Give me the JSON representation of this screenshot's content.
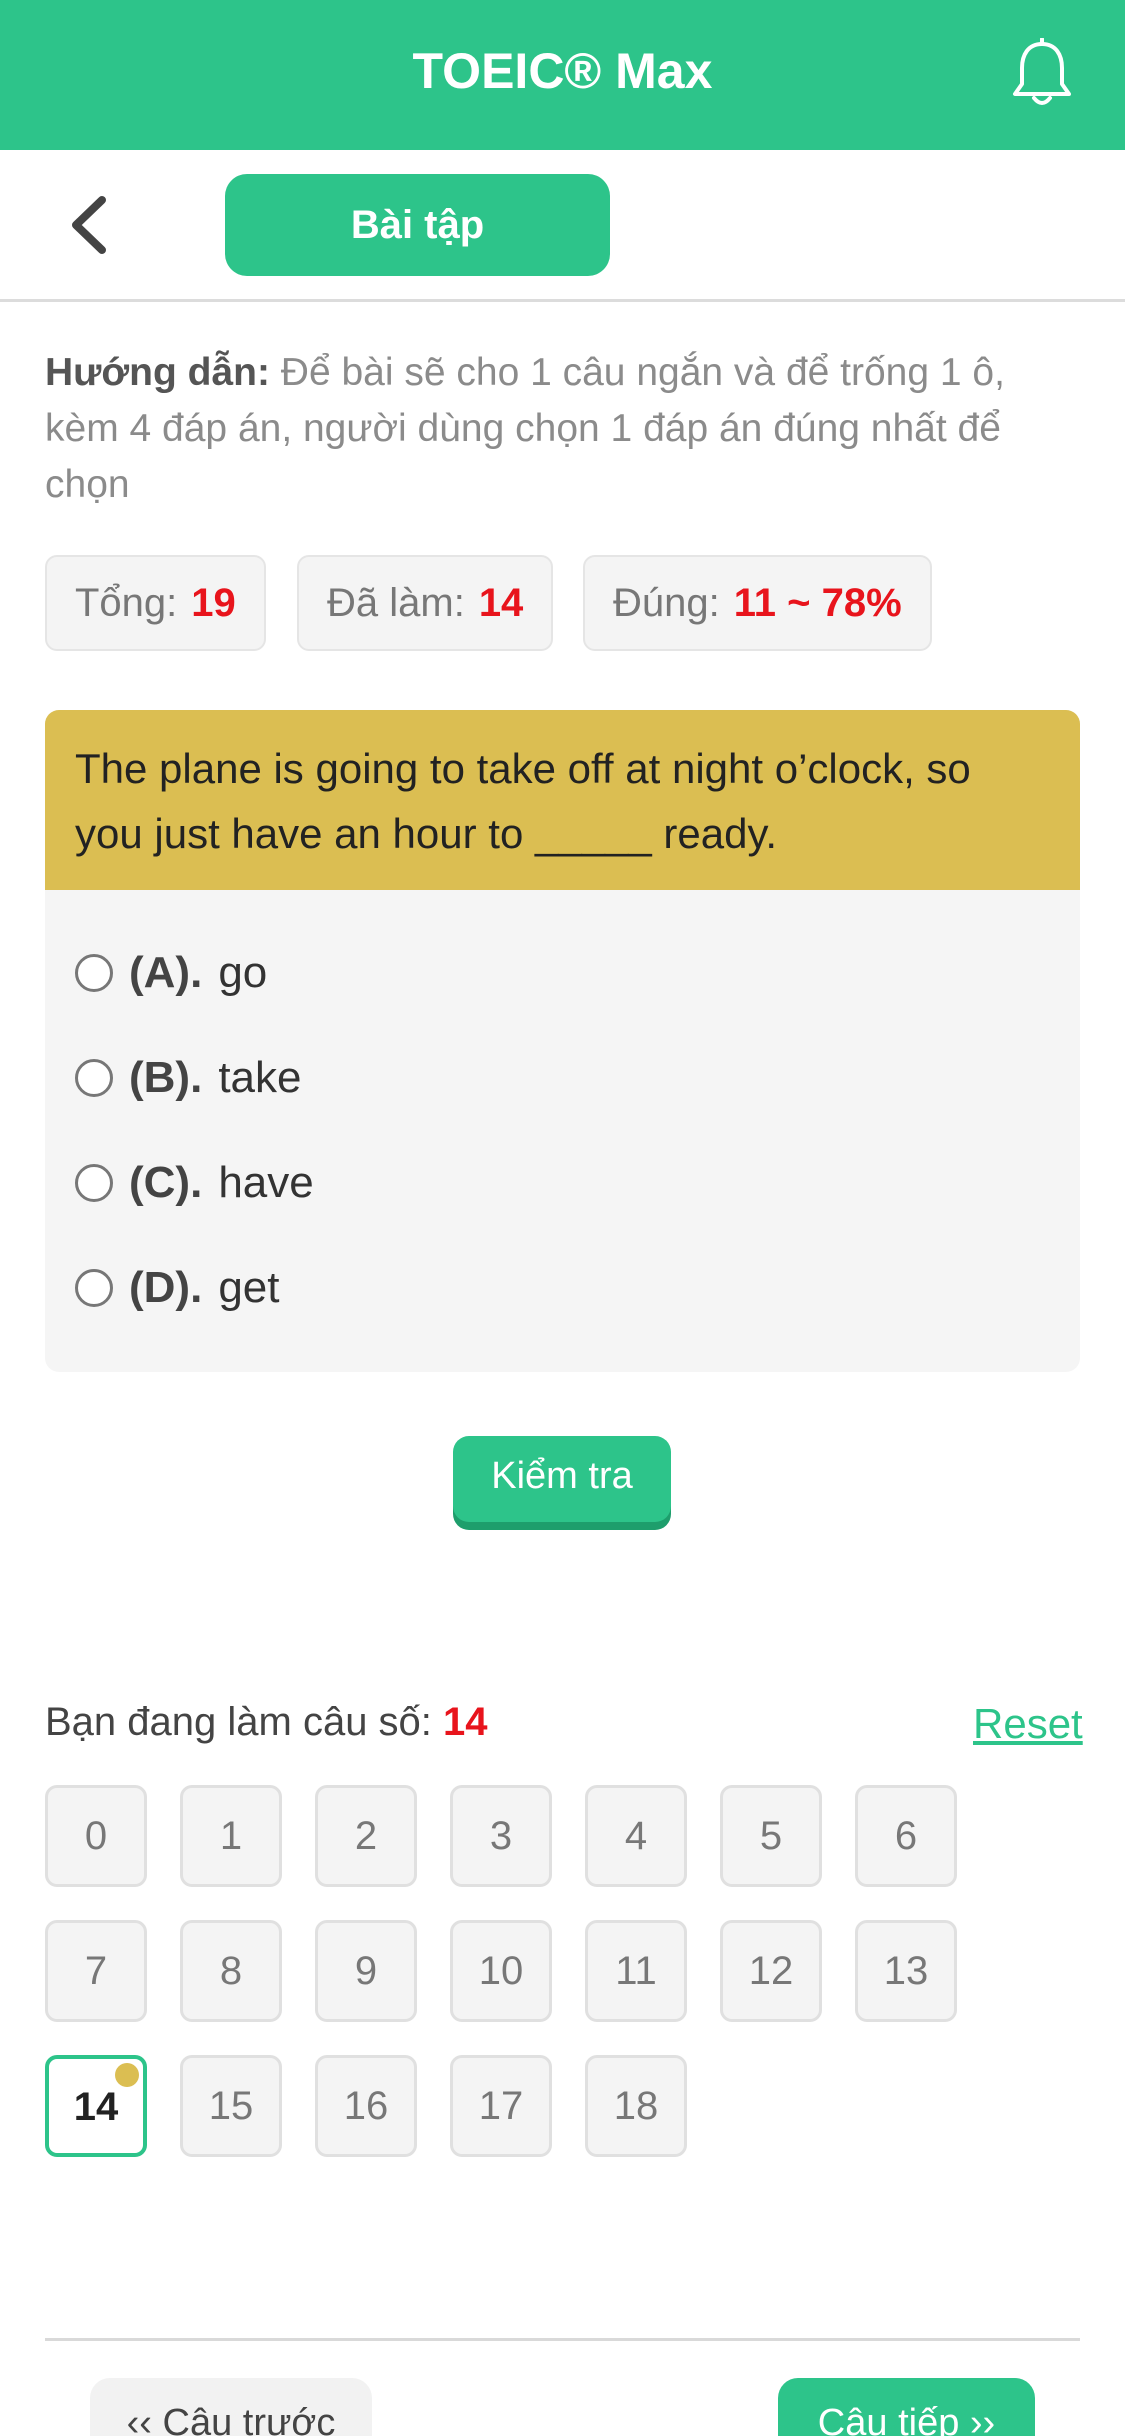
{
  "app": {
    "title": "TOEIC® Max"
  },
  "subbar": {
    "tab_label": "Bài tập"
  },
  "instructions": {
    "label": "Hướng dẫn:",
    "text": "Để bài sẽ cho 1 câu ngắn và để trống 1 ô, kèm 4 đáp án, người dùng chọn 1 đáp án đúng nhất để chọn"
  },
  "stats": {
    "total_label": "Tổng:",
    "total_value": "19",
    "done_label": "Đã làm:",
    "done_value": "14",
    "correct_label": "Đúng:",
    "correct_value": "11 ~ 78%"
  },
  "question": {
    "text": "The plane is going to take off at night o’clock, so you just have an hour to _____ ready.",
    "options": [
      {
        "letter": "(A).",
        "text": "go"
      },
      {
        "letter": "(B).",
        "text": "take"
      },
      {
        "letter": "(C).",
        "text": "have"
      },
      {
        "letter": "(D).",
        "text": "get"
      }
    ]
  },
  "check_button": "Kiểm tra",
  "progress": {
    "current_label": "Bạn đang làm câu số:",
    "current_value": "14",
    "reset_label": "Reset",
    "numbers": [
      "0",
      "1",
      "2",
      "3",
      "4",
      "5",
      "6",
      "7",
      "8",
      "9",
      "10",
      "11",
      "12",
      "13",
      "14",
      "15",
      "16",
      "17",
      "18"
    ]
  },
  "nav": {
    "prev_label": "‹‹ Câu trước",
    "next_label": "Câu tiếp ››"
  },
  "colors": {
    "brand": "#2dc48a",
    "question_bg": "#dbbe52",
    "accent_red": "#e8141c"
  }
}
